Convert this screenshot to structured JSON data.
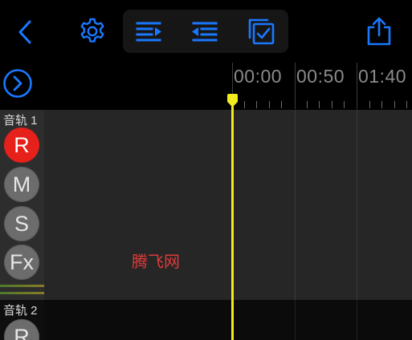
{
  "toolbar": {
    "back_icon": "chevron-left-icon",
    "settings_icon": "gear-icon",
    "group_icons": [
      "indent-right-icon",
      "outdent-left-icon",
      "select-all-icon"
    ],
    "share_icon": "share-icon",
    "accent_color": "#1a78ff"
  },
  "timeline": {
    "expand_icon": "circle-chevron-right-icon",
    "ruler_labels": [
      "00:00",
      "00:50",
      "01:40"
    ],
    "playhead_color": "#f1ea1c"
  },
  "tracks": [
    {
      "name": "音轨 1",
      "buttons": [
        "R",
        "M",
        "S",
        "Fx"
      ],
      "record_color": "#e6201b"
    },
    {
      "name": "音轨 2",
      "buttons": [
        "R"
      ]
    }
  ],
  "watermark": "腾飞网"
}
